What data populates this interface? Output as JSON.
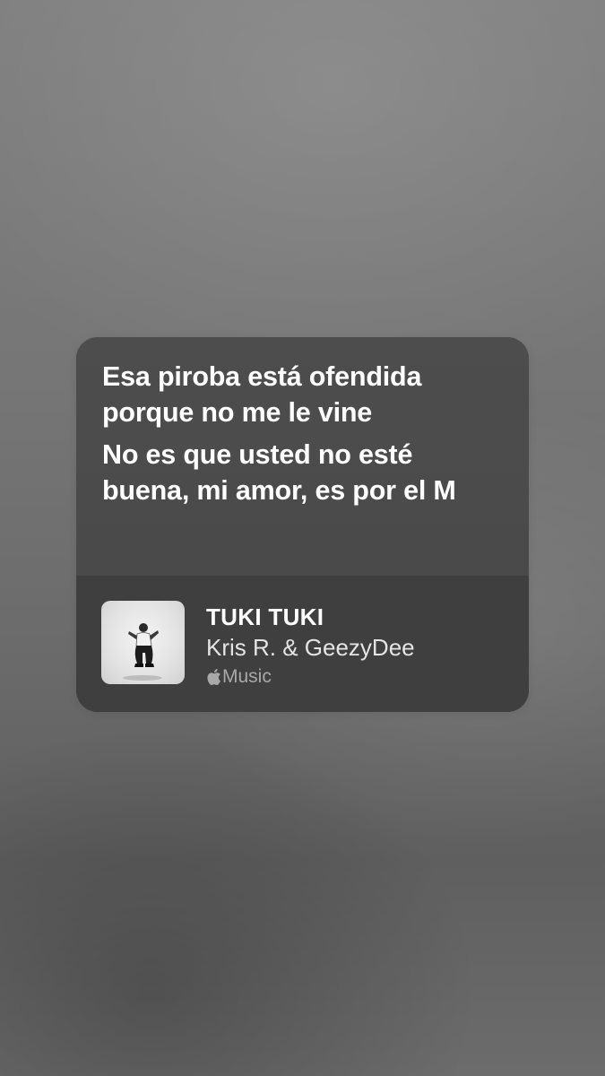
{
  "lyrics": {
    "lines": [
      "Esa piroba está ofendida porque no me le vine",
      "No es que usted no esté buena, mi amor, es por el M"
    ]
  },
  "song": {
    "title": "TUKI TUKI",
    "artist": "Kris R. & GeezyDee",
    "service": "Music",
    "service_icon": "apple-icon",
    "artwork": "album-artwork"
  },
  "colors": {
    "card_top": "#4b4b4b",
    "card_bottom": "#3f3f3f",
    "text_primary": "#ffffff",
    "text_secondary": "#e4e4e4",
    "text_tertiary": "#a8a8a8"
  }
}
